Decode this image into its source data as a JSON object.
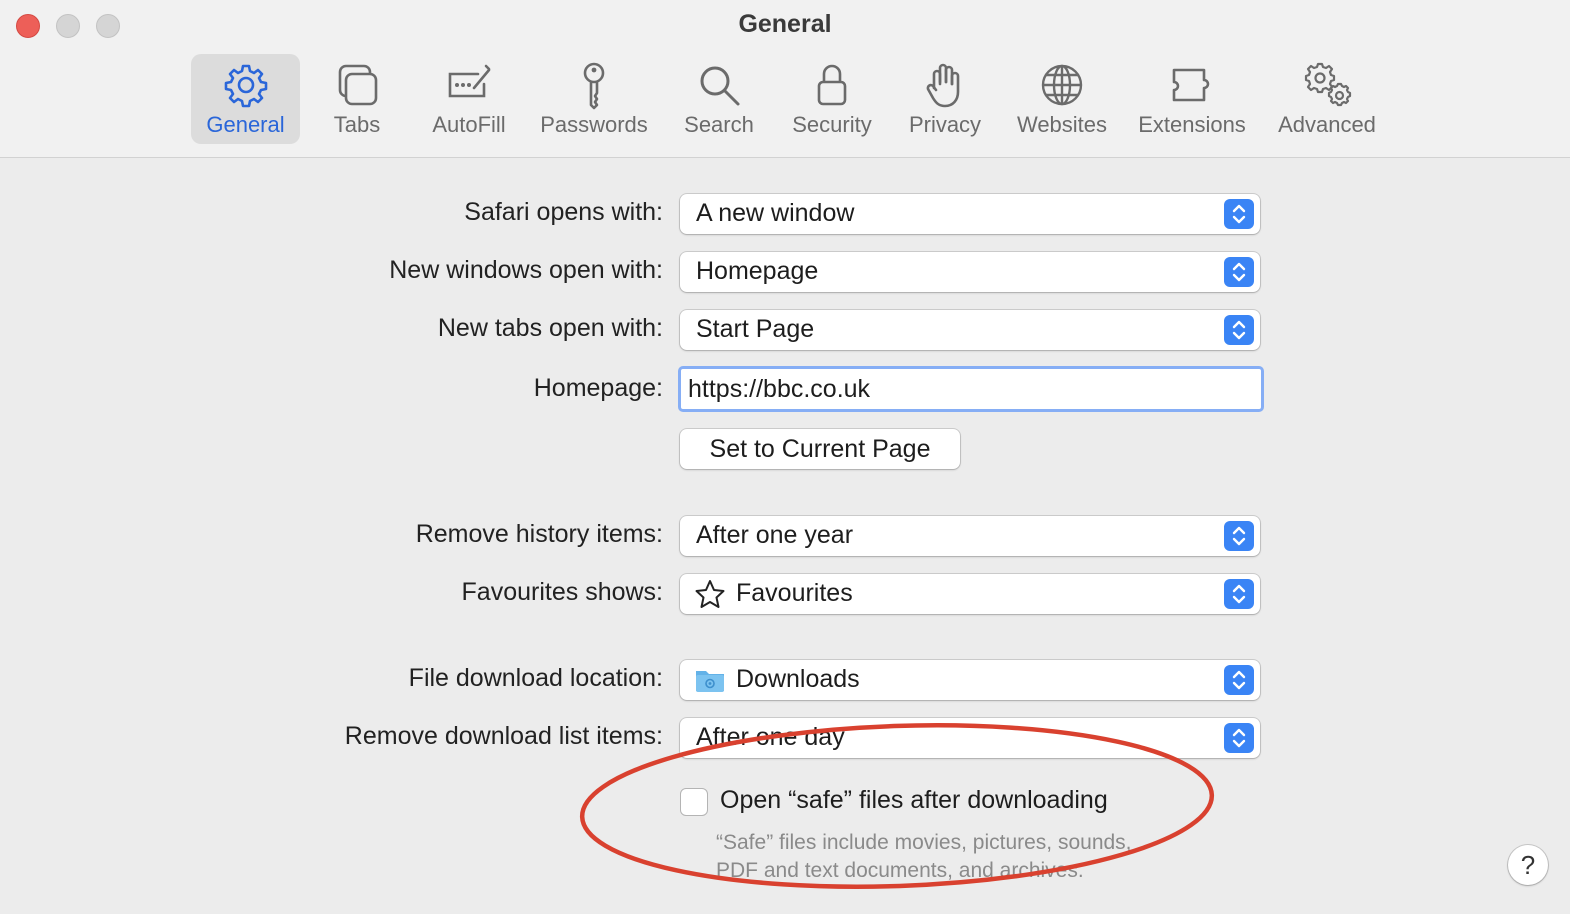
{
  "window": {
    "title": "General"
  },
  "toolbar": {
    "tabs": [
      {
        "label": "General",
        "icon": "gear-icon",
        "active": true
      },
      {
        "label": "Tabs",
        "icon": "tabs-icon"
      },
      {
        "label": "AutoFill",
        "icon": "autofill-icon"
      },
      {
        "label": "Passwords",
        "icon": "key-icon"
      },
      {
        "label": "Search",
        "icon": "magnifier-icon"
      },
      {
        "label": "Security",
        "icon": "lock-icon"
      },
      {
        "label": "Privacy",
        "icon": "hand-icon"
      },
      {
        "label": "Websites",
        "icon": "globe-icon"
      },
      {
        "label": "Extensions",
        "icon": "puzzle-icon"
      },
      {
        "label": "Advanced",
        "icon": "gears-icon"
      }
    ]
  },
  "settings": {
    "safari_opens_with": {
      "label": "Safari opens with:",
      "value": "A new window"
    },
    "new_windows_open_with": {
      "label": "New windows open with:",
      "value": "Homepage"
    },
    "new_tabs_open_with": {
      "label": "New tabs open with:",
      "value": "Start Page"
    },
    "homepage": {
      "label": "Homepage:",
      "value": "https://bbc.co.uk"
    },
    "set_current_page": {
      "label": "Set to Current Page"
    },
    "remove_history": {
      "label": "Remove history items:",
      "value": "After one year"
    },
    "favourites_shows": {
      "label": "Favourites shows:",
      "value": "Favourites",
      "icon": "star-icon"
    },
    "download_location": {
      "label": "File download location:",
      "value": "Downloads",
      "icon": "folder-icon"
    },
    "remove_download_items": {
      "label": "Remove download list items:",
      "value": "After one day"
    },
    "open_safe_files": {
      "label": "Open “safe” files after downloading",
      "checked": false
    },
    "safe_files_help": {
      "line1": "“Safe” files include movies, pictures, sounds,",
      "line2": "PDF and text documents, and archives."
    }
  },
  "help_button": {
    "label": "?"
  },
  "colors": {
    "accent": "#3a84f5",
    "annotation": "#d9412f",
    "close": "#ed5f58"
  }
}
